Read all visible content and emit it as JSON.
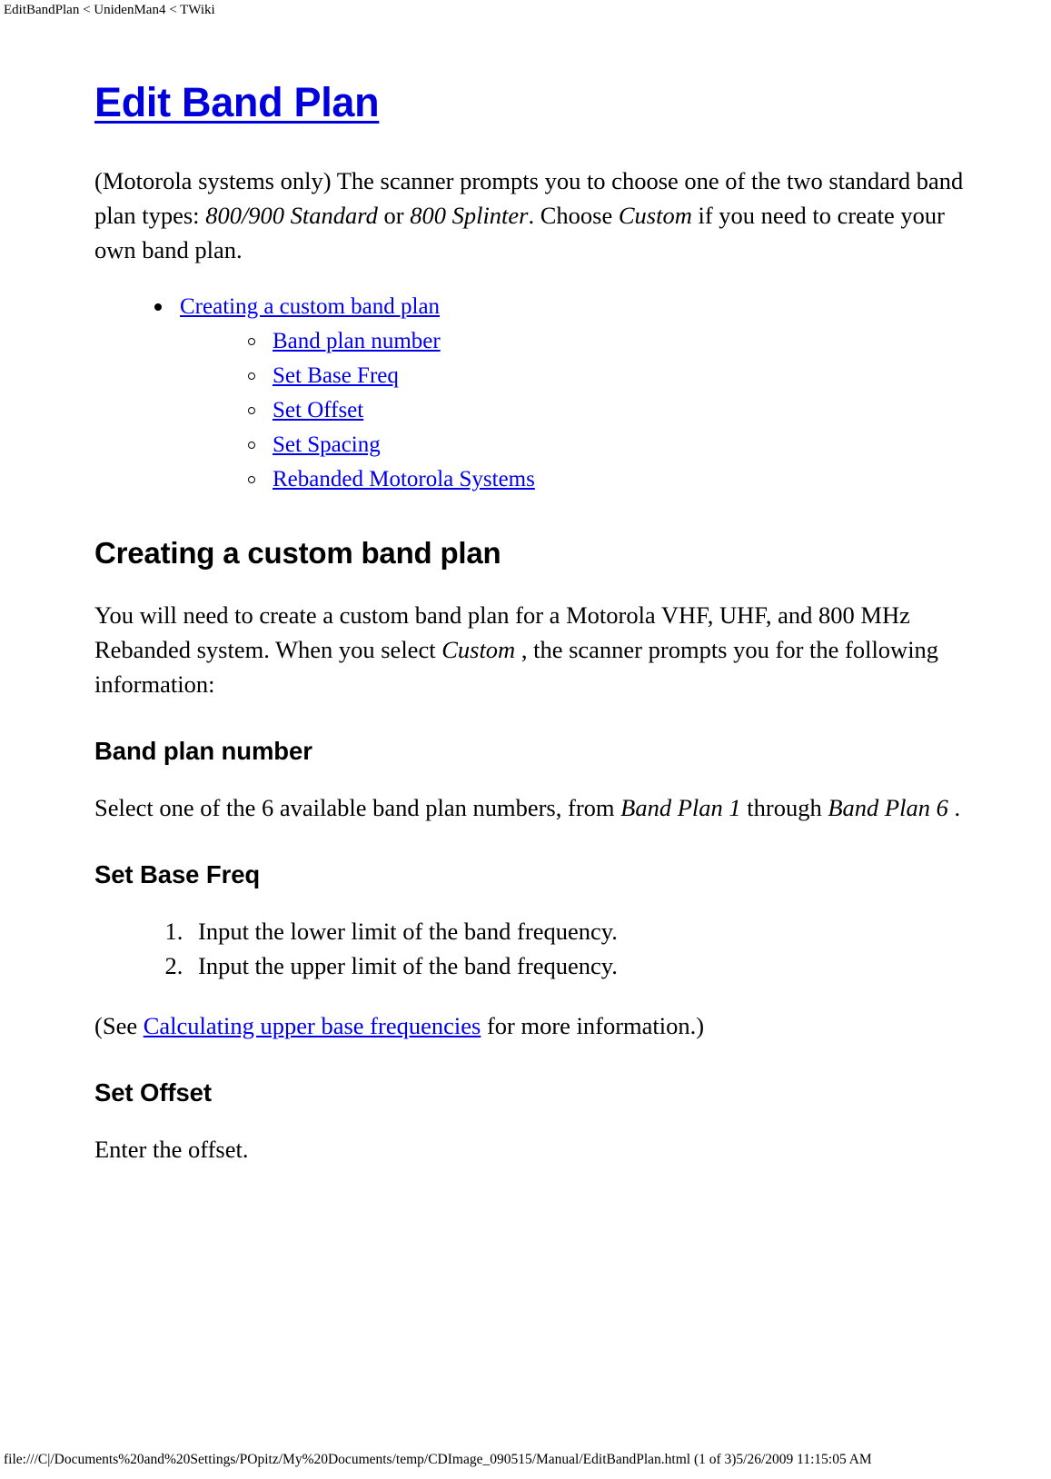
{
  "print_header": "EditBandPlan < UnidenMan4 < TWiki",
  "title": {
    "text": "Edit Band Plan",
    "link_color": "#0000dd"
  },
  "intro": {
    "part1": "(Motorola systems only) The scanner prompts you to choose one of the two standard band plan types: ",
    "em1": "800/900 Standard",
    "part2": " or ",
    "em2": "800 Splinter",
    "part3": ". Choose ",
    "em3": "Custom",
    "part4": " if you need to create your own band plan."
  },
  "toc": {
    "top": {
      "label": "Creating a custom band plan"
    },
    "items": [
      {
        "label": "Band plan number"
      },
      {
        "label": "Set Base Freq"
      },
      {
        "label": "Set Offset"
      },
      {
        "label": "Set Spacing"
      },
      {
        "label": "Rebanded Motorola Systems"
      }
    ]
  },
  "sections": {
    "creating": {
      "heading": "Creating a custom band plan",
      "body": {
        "part1": "You will need to create a custom band plan for a Motorola VHF, UHF, and 800 MHz Rebanded system. When you select ",
        "em1": "Custom ",
        "part2": ", the scanner prompts you for the following information:"
      }
    },
    "band_plan_number": {
      "heading": "Band plan number",
      "body": {
        "part1": "Select one of the 6 available band plan numbers, from ",
        "em1": "Band Plan 1",
        "part2": " through ",
        "em2": "Band Plan 6",
        "part3": " ."
      }
    },
    "set_base_freq": {
      "heading": "Set Base Freq",
      "steps": [
        "Input the lower limit of the band frequency.",
        "Input the upper limit of the band frequency."
      ],
      "see_note": {
        "part1": "(See ",
        "link": "Calculating upper base frequencies",
        "part2": " for more information.)"
      }
    },
    "set_offset": {
      "heading": "Set Offset",
      "body": "Enter the offset."
    }
  },
  "print_footer": "file:///C|/Documents%20and%20Settings/POpitz/My%20Documents/temp/CDImage_090515/Manual/EditBandPlan.html (1 of 3)5/26/2009 11:15:05 AM"
}
